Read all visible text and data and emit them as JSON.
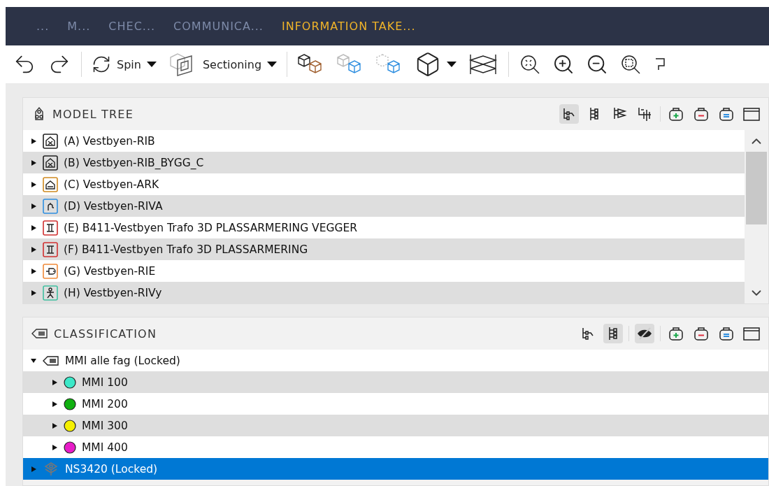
{
  "tabs": [
    {
      "label": "...",
      "selected": false
    },
    {
      "label": "M...",
      "selected": false
    },
    {
      "label": "CHEC...",
      "selected": false
    },
    {
      "label": "COMMUNICA...",
      "selected": false
    },
    {
      "label": "INFORMATION TAKE...",
      "selected": true
    }
  ],
  "toolbar": {
    "spin": {
      "label": "Spin"
    },
    "sectioning": {
      "label": "Sectioning"
    }
  },
  "model_tree": {
    "title": "MODEL TREE",
    "tools": [
      {
        "kind": "tree",
        "selected": true
      },
      {
        "kind": "list",
        "selected": false
      },
      {
        "kind": "layers",
        "selected": false
      },
      {
        "kind": "split",
        "selected": false
      },
      {
        "kind": "add",
        "selected": false
      },
      {
        "kind": "remove",
        "selected": false
      },
      {
        "kind": "equal",
        "selected": false
      },
      {
        "kind": "window",
        "selected": false
      }
    ],
    "items": [
      {
        "label": "(A) Vestbyen-RIB",
        "kind": "building",
        "color": "#222222",
        "expanded": false
      },
      {
        "label": "(B) Vestbyen-RIB_BYGG_C",
        "kind": "building",
        "color": "#222222",
        "expanded": false
      },
      {
        "label": "(C) Vestbyen-ARK",
        "kind": "house",
        "color": "#d08a20",
        "expanded": false
      },
      {
        "label": "(D) Vestbyen-RIVA",
        "kind": "pipe",
        "color": "#2f8fe0",
        "expanded": false
      },
      {
        "label": "(E) B411-Vestbyen Trafo 3D PLASSARMERING VEGGER",
        "kind": "beam",
        "color": "#d03030",
        "expanded": false
      },
      {
        "label": "(F) B411-Vestbyen Trafo 3D PLASSARMERING",
        "kind": "beam",
        "color": "#d03030",
        "expanded": false
      },
      {
        "label": "(G) Vestbyen-RIE",
        "kind": "plug",
        "color": "#f08a3a",
        "expanded": false
      },
      {
        "label": "(H) Vestbyen-RIVy",
        "kind": "figure",
        "color": "#40c0a0",
        "expanded": false
      }
    ]
  },
  "classification": {
    "title": "CLASSIFICATION",
    "tools": [
      {
        "kind": "tree",
        "selected": false
      },
      {
        "kind": "list",
        "selected": true
      },
      {
        "kind": "hide",
        "selected": true
      },
      {
        "kind": "add",
        "selected": false
      },
      {
        "kind": "remove",
        "selected": false
      },
      {
        "kind": "equal",
        "selected": false
      },
      {
        "kind": "window",
        "selected": false
      }
    ],
    "items": [
      {
        "label": "MMI alle fag (Locked)",
        "kind": "tag",
        "expanded": true,
        "selected": false,
        "children": [
          {
            "label": "MMI 100",
            "kind": "dot",
            "color": "#3ce8c8",
            "expanded": false,
            "selected": false
          },
          {
            "label": "MMI 200",
            "kind": "dot",
            "color": "#10b010",
            "expanded": false,
            "selected": false
          },
          {
            "label": "MMI 300",
            "kind": "dot",
            "color": "#f5f000",
            "expanded": false,
            "selected": false
          },
          {
            "label": "MMI 400",
            "kind": "dot",
            "color": "#e81cc8",
            "expanded": false,
            "selected": false
          }
        ]
      },
      {
        "label": "NS3420 (Locked)",
        "kind": "network",
        "expanded": false,
        "selected": true
      }
    ]
  }
}
